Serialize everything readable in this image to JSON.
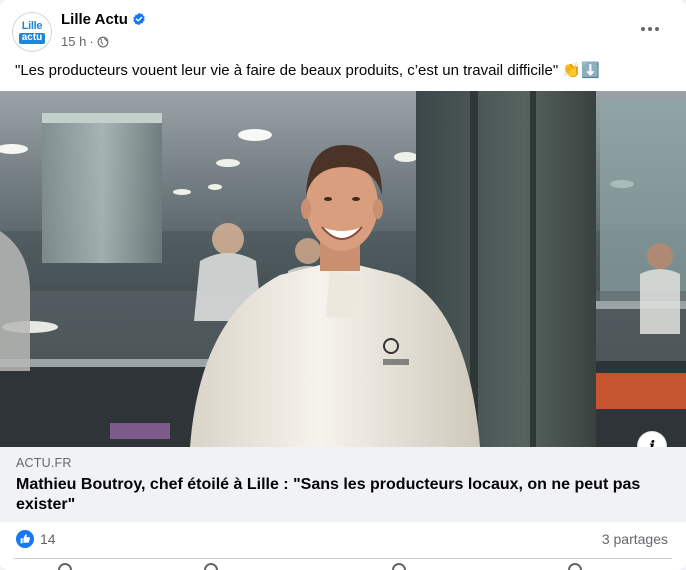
{
  "post": {
    "page_name": "Lille Actu",
    "avatar_line1": "Lille",
    "avatar_line2": "actu",
    "time": "15 h",
    "separator": "·",
    "privacy_icon": "globe-icon",
    "verified_icon": "verified-badge-icon",
    "more_icon": "more-options-icon",
    "caption": "\"Les producteurs vouent leur vie à faire de beaux produits, c’est un travail difficile\" 👏⬇️"
  },
  "link": {
    "domain": "ACTU.FR",
    "title": "Mathieu Boutroy, chef étoilé à Lille : \"Sans les producteurs locaux, on ne peut pas exister\"",
    "info_icon": "info-icon",
    "info_label": "i"
  },
  "stats": {
    "reaction_icon": "like-icon",
    "likes": "14",
    "shares": "3 partages"
  },
  "colors": {
    "accent": "#1877f2",
    "secondary_text": "#65676b",
    "link_background": "#f0f2f5"
  }
}
